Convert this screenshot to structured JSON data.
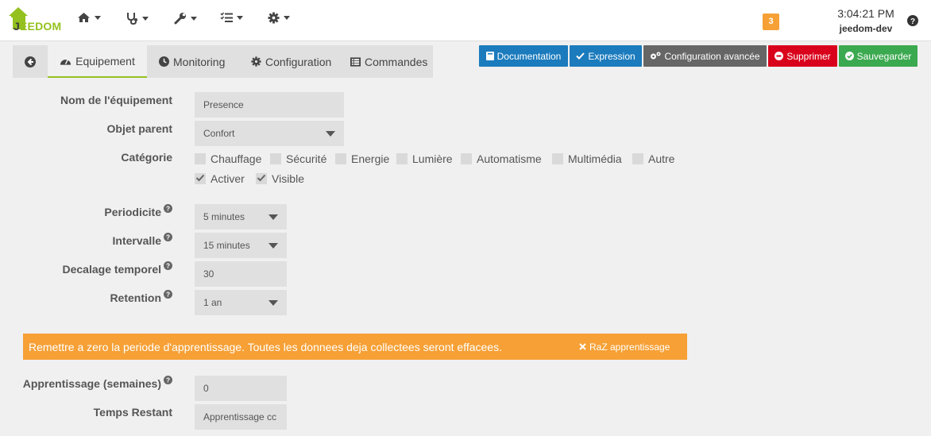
{
  "brand": {
    "logo_text_1": "J",
    "logo_text_2": "EEDOM"
  },
  "nav": {
    "items": [
      {
        "icon": "home-icon"
      },
      {
        "icon": "stethoscope-icon"
      },
      {
        "icon": "wrench-icon"
      },
      {
        "icon": "list-check-icon"
      },
      {
        "icon": "gear-icon"
      }
    ]
  },
  "header": {
    "notification_count": "3",
    "time": "3:04:21 PM",
    "hostname": "jeedom-dev"
  },
  "tabs": [
    {
      "label": "Equipement",
      "icon": "dashboard-icon",
      "active": true
    },
    {
      "label": "Monitoring",
      "icon": "clock-icon",
      "active": false
    },
    {
      "label": "Configuration",
      "icon": "gear-icon",
      "active": false
    },
    {
      "label": "Commandes",
      "icon": "list-icon",
      "active": false
    }
  ],
  "actions": {
    "documentation": "Documentation",
    "expression": "Expression",
    "advanced": "Configuration avancée",
    "delete": "Supprimer",
    "save": "Sauvegarder"
  },
  "form": {
    "name_label": "Nom de l'équipement",
    "name_value": "Presence",
    "parent_label": "Objet parent",
    "parent_value": "Confort",
    "category_label": "Catégorie",
    "categories": [
      {
        "label": "Chauffage",
        "checked": false
      },
      {
        "label": "Sécurité",
        "checked": false
      },
      {
        "label": "Energie",
        "checked": false
      },
      {
        "label": "Lumière",
        "checked": false
      },
      {
        "label": "Automatisme",
        "checked": false
      },
      {
        "label": "Multimédia",
        "checked": false
      },
      {
        "label": "Autre",
        "checked": false
      }
    ],
    "activate_label": "Activer",
    "visible_label": "Visible",
    "periodicite_label": "Periodicite",
    "periodicite_value": "5 minutes",
    "intervalle_label": "Intervalle",
    "intervalle_value": "15 minutes",
    "decalage_label": "Decalage temporel",
    "decalage_value": "30",
    "retention_label": "Retention",
    "retention_value": "1 an",
    "warning_text": "Remettre a zero la periode d'apprentissage. Toutes les donnees deja collectees seront effacees.",
    "raz_label": "RaZ apprentissage",
    "apprentissage_label": "Apprentissage (semaines)",
    "apprentissage_value": "0",
    "temps_label": "Temps Restant",
    "temps_value": "Apprentissage cc"
  },
  "colors": {
    "brand_green": "#94c11f",
    "primary_blue": "#1b7bbd",
    "danger_red": "#d9001b",
    "success_green": "#3ba94f",
    "warning_orange": "#f6a035"
  }
}
